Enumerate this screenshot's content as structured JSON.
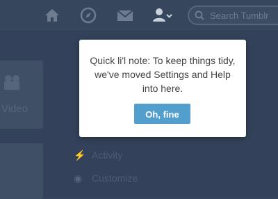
{
  "header": {
    "nav": [
      {
        "icon": "home-icon"
      },
      {
        "icon": "compass-icon"
      },
      {
        "icon": "mail-icon"
      },
      {
        "icon": "account-icon"
      }
    ],
    "search": {
      "placeholder": "Search Tumblr"
    }
  },
  "background": {
    "video_tile_label": "Video",
    "menu": [
      {
        "icon": "activity-icon",
        "label": "Activity"
      },
      {
        "icon": "eye-icon",
        "label": "Customize"
      }
    ]
  },
  "popover": {
    "message": "Quick li'l note: To keep things tidy, we've moved Settings and Help into here.",
    "button_label": "Oh, fine"
  },
  "colors": {
    "background": "#36465d",
    "button": "#529ecc",
    "icon": "#6d7c91",
    "active_icon": "#c9d1db"
  }
}
